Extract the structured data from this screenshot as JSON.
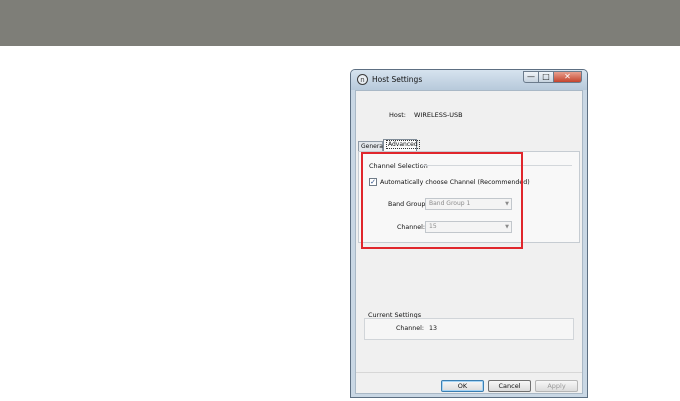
{
  "window": {
    "title": "Host Settings",
    "icon_glyph": "n",
    "buttons": {
      "minimize": "—",
      "maximize": "□",
      "close": "✕"
    }
  },
  "host": {
    "label": "Host:",
    "value": "WIRELESS-USB"
  },
  "tabs": [
    {
      "label": "General",
      "selected": false
    },
    {
      "label": "Advanced",
      "selected": true
    }
  ],
  "channel_selection": {
    "title": "Channel Selection",
    "auto_checkbox": {
      "label": "Automatically choose Channel (Recommended)",
      "checked": true,
      "check_glyph": "✓"
    },
    "band_group": {
      "label": "Band Group:",
      "value": "Band Group 1",
      "disabled": true
    },
    "channel": {
      "label": "Channel:",
      "value": "15",
      "disabled": true
    }
  },
  "current_settings": {
    "title": "Current Settings",
    "channel_label": "Channel:",
    "channel_value": "13"
  },
  "footer": {
    "ok": "OK",
    "cancel": "Cancel",
    "apply": "Apply"
  },
  "colors": {
    "highlight": "#e0262c",
    "top_band": "#7e7e78"
  }
}
